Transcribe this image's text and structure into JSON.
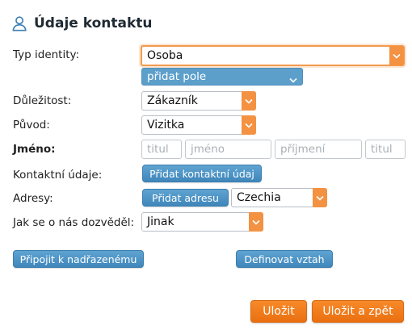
{
  "header": {
    "title": "Údaje kontaktu",
    "icon": "user-icon"
  },
  "colors": {
    "accent_orange": "#ee7418",
    "accent_blue": "#4a8fc2"
  },
  "fields": {
    "identity_type": {
      "label": "Typ identity:",
      "value": "Osoba"
    },
    "add_field": {
      "label": "přidat pole"
    },
    "importance": {
      "label": "Důležitost:",
      "value": "Zákazník"
    },
    "origin": {
      "label": "Původ:",
      "value": "Vizitka"
    },
    "name": {
      "label": "Jméno:",
      "title_before_placeholder": "titul",
      "first_name_placeholder": "jméno",
      "surname_placeholder": "příjmení",
      "title_after_placeholder": "titul"
    },
    "contact_info": {
      "label": "Kontaktní údaje:",
      "button": "Přidat kontaktní údaj"
    },
    "addresses": {
      "label": "Adresy:",
      "button": "Přidat adresu",
      "country": "Czechia"
    },
    "referral": {
      "label": "Jak se o nás dozvěděl:",
      "value": "Jinak"
    }
  },
  "actions": {
    "attach_parent": "Připojit k nadřazenému",
    "define_relation": "Definovat vztah",
    "save": "Uložit",
    "save_back": "Uložit a zpět"
  }
}
